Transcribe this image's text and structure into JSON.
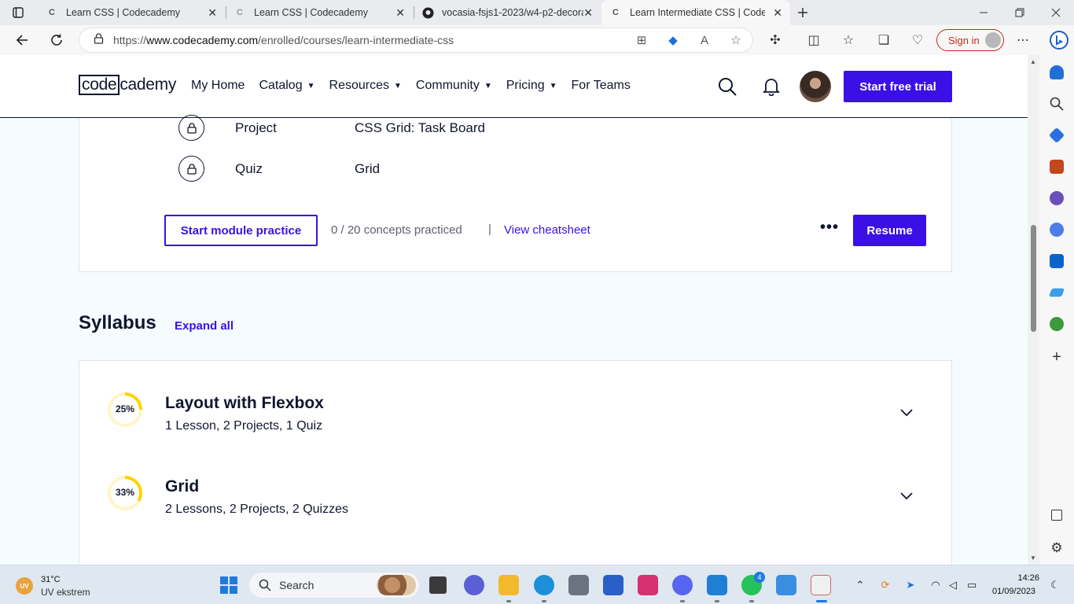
{
  "browser": {
    "tabs": [
      {
        "label": "Learn CSS | Codecademy",
        "active": false
      },
      {
        "label": "Learn CSS | Codecademy",
        "active": false
      },
      {
        "label": "vocasia-fsjs1-2023/w4-p2-decora",
        "active": false
      },
      {
        "label": "Learn Intermediate CSS | Codeca",
        "active": true
      }
    ],
    "url_prefix": "https://",
    "url_host": "www.codecademy.com",
    "url_path": "/enrolled/courses/learn-intermediate-css",
    "sign_in_label": "Sign in",
    "accent": "#c42b1c"
  },
  "header": {
    "logo_left": "code",
    "logo_right": "cademy",
    "nav": [
      {
        "label": "My Home",
        "dropdown": false
      },
      {
        "label": "Catalog",
        "dropdown": true
      },
      {
        "label": "Resources",
        "dropdown": true
      },
      {
        "label": "Community",
        "dropdown": true
      },
      {
        "label": "Pricing",
        "dropdown": true
      },
      {
        "label": "For Teams",
        "dropdown": false
      }
    ],
    "trial_button": "Start free trial",
    "brand_color": "#3a10e5"
  },
  "module": {
    "items": [
      {
        "type": "Project",
        "name": "CSS Grid: Task Board",
        "icon": "lock-icon"
      },
      {
        "type": "Quiz",
        "name": "Grid",
        "icon": "lock-icon"
      }
    ],
    "practice_button": "Start module practice",
    "concepts_text": "0 / 20 concepts practiced",
    "separator": "|",
    "cheatsheet_link": "View cheatsheet",
    "more_label": "•••",
    "resume_button": "Resume"
  },
  "syllabus": {
    "title": "Syllabus",
    "expand_all": "Expand all",
    "items": [
      {
        "progress_label": "25%",
        "progress": 0.25,
        "title": "Layout with Flexbox",
        "summary": "1 Lesson, 2 Projects, 1 Quiz"
      },
      {
        "progress_label": "33%",
        "progress": 0.33,
        "title": "Grid",
        "summary": "2 Lessons, 2 Projects, 2 Quizzes"
      }
    ],
    "ring_color": "#ffd300"
  },
  "taskbar": {
    "weather_badge": "UV",
    "temperature": "31°C",
    "weather_desc": "UV ekstrem",
    "search_label": "Search",
    "whatsapp_badge": "4",
    "time": "14:26",
    "date": "01/09/2023"
  }
}
